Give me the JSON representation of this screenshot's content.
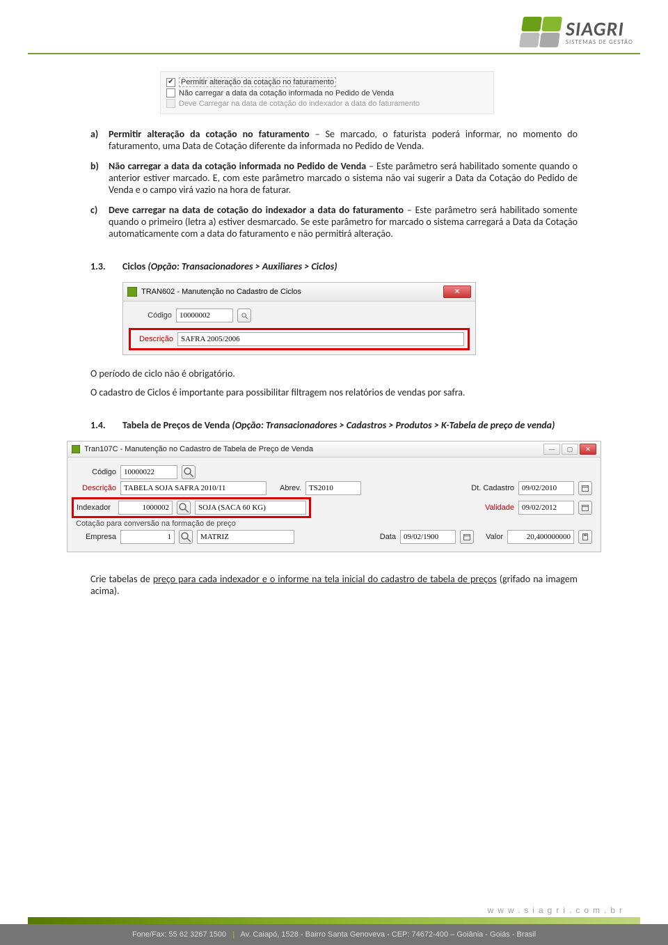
{
  "header": {
    "brand": "SIAGRI",
    "tagline": "SISTEMAS DE GESTÃO"
  },
  "checkbox_block": {
    "row1": {
      "checked": true,
      "label": "Permitir alteração da cotação no faturamento"
    },
    "row2": {
      "checked": false,
      "label": "Não carregar a data da cotação informada no Pedido de Venda"
    },
    "row3": {
      "checked": false,
      "label": "Deve Carregar na data de cotação do indexador a data do faturamento"
    }
  },
  "items": {
    "a": {
      "marker": "a)",
      "bold": "Permitir alteração da cotação no faturamento",
      "rest": " – Se marcado, o faturista poderá informar, no momento do faturamento, uma Data de Cotação diferente da informada no Pedido de Venda."
    },
    "b": {
      "marker": "b)",
      "bold": "Não carregar a data da cotação informada no Pedido de Venda",
      "rest": " – Este parâmetro será habilitado somente quando o anterior estiver marcado. E, com este parâmetro marcado o sistema não vai sugerir a Data da Cotação do Pedido de Venda e o campo virá vazio na hora de faturar."
    },
    "c": {
      "marker": "c)",
      "bold": "Deve carregar na data de cotação do indexador a data do faturamento",
      "rest": " – Este parâmetro será habilitado somente quando o primeiro (letra a) estiver desmarcado. Se este parâmetro for marcado o sistema carregará a Data da Cotação automaticamente com a data do faturamento e não permitirá alteração."
    }
  },
  "section13": {
    "num": "1.3.",
    "title": "Ciclos ",
    "sub": "(Opção: Transacionadores > Auxiliares > Ciclos)"
  },
  "win1": {
    "title": "TRAN602 - Manutenção no Cadastro de Ciclos",
    "codigo_label": "Código",
    "codigo": "10000002",
    "descricao_label": "Descrição",
    "descricao": "SAFRA 2005/2006"
  },
  "after_win1": {
    "p1": "O período de ciclo não é obrigatório.",
    "p2": "O cadastro de Ciclos é importante para possibilitar filtragem nos relatórios de vendas por safra."
  },
  "section14": {
    "num": "1.4.",
    "title": "Tabela de Preços de Venda ",
    "sub": "(Opção: Transacionadores > Cadastros > Produtos > K-Tabela de preço de venda)"
  },
  "win2": {
    "title": "Tran107C - Manutenção no Cadastro de Tabela de Preço de Venda",
    "codigo_label": "Código",
    "codigo": "10000022",
    "descricao_label": "Descrição",
    "descricao": "TABELA SOJA SAFRA 2010/11",
    "abrev_label": "Abrev.",
    "abrev": "TS2010",
    "dtcad_label": "Dt. Cadastro",
    "dtcad": "09/02/2010",
    "indexador_label": "Indexador",
    "indexador_cod": "1000002",
    "indexador_desc": "SOJA (SACA 60 KG)",
    "validade_label": "Validade",
    "validade": "09/02/2012",
    "groupline": "Cotação para conversão na formação de preço",
    "empresa_label": "Empresa",
    "empresa_cod": "1",
    "empresa_desc": "MATRIZ",
    "data_label": "Data",
    "data": "09/02/1900",
    "valor_label": "Valor",
    "valor": "20,400000000"
  },
  "after_win2": {
    "pre": "Crie tabelas de ",
    "u1": "preço para cada indexador e o informe na tela inicial do cadastro de tabela de preços",
    "post": " (grifado na imagem acima)."
  },
  "footer": {
    "url": "www.siagri.com.br",
    "line_a": "Fone/Fax: 55 62 3267 1500",
    "line_b": "Av. Caiapó, 1528 - Bairro Santa Genoveva - CEP: 74672-400 – Goiânia - Goiás - Brasil"
  }
}
